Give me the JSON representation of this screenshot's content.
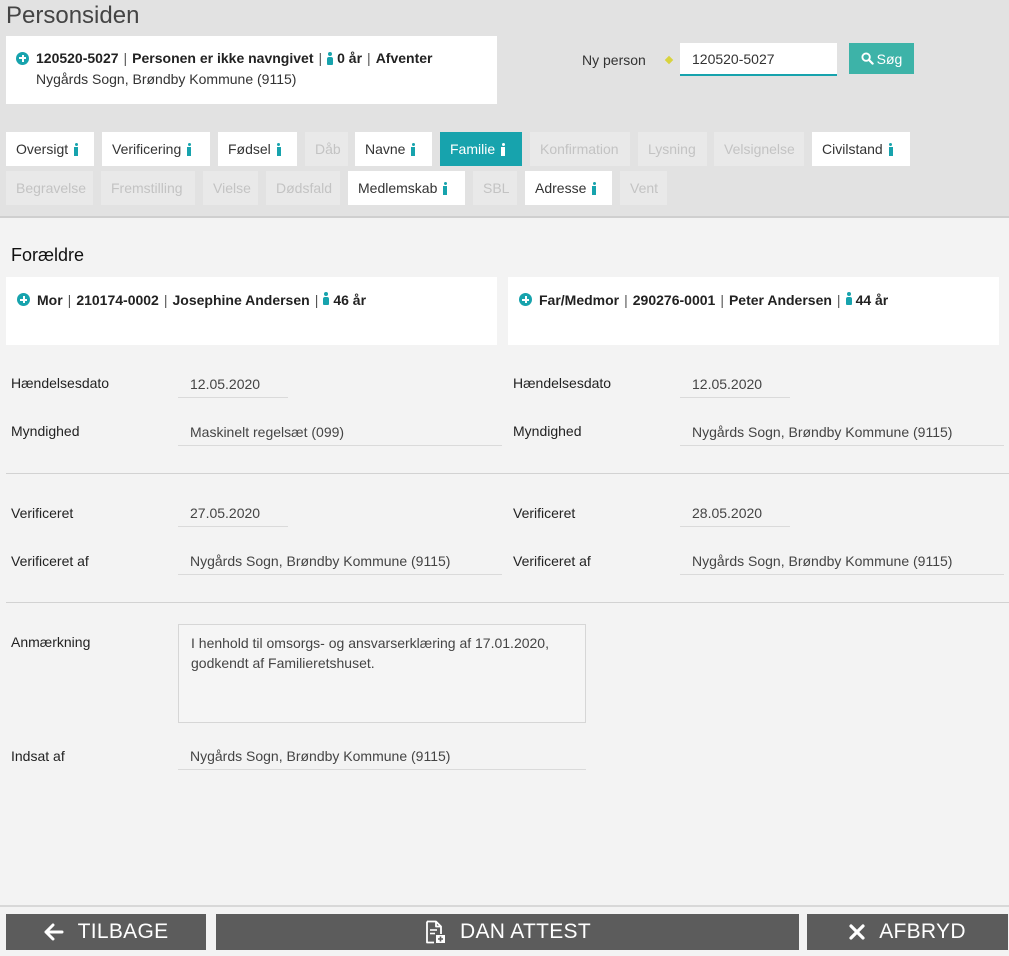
{
  "page_title": "Personsiden",
  "person": {
    "cpr": "120520-5027",
    "name": "Personen er ikke navngivet",
    "age": "0 år",
    "status": "Afventer",
    "authority": "Nygårds Sogn, Brøndby Kommune (9115)"
  },
  "search": {
    "label": "Ny person",
    "value": "120520-5027",
    "button_label": "Søg"
  },
  "tabs": [
    {
      "label": "Oversigt",
      "state": "enabled",
      "info": true
    },
    {
      "label": "Verificering",
      "state": "enabled",
      "info": true
    },
    {
      "label": "Fødsel",
      "state": "enabled",
      "info": true
    },
    {
      "label": "Dåb",
      "state": "disabled",
      "info": false
    },
    {
      "label": "Navne",
      "state": "enabled",
      "info": true
    },
    {
      "label": "Familie",
      "state": "active",
      "info": true
    },
    {
      "label": "Konfirmation",
      "state": "disabled",
      "info": false
    },
    {
      "label": "Lysning",
      "state": "disabled",
      "info": false
    },
    {
      "label": "Velsignelse",
      "state": "disabled",
      "info": false
    },
    {
      "label": "Civilstand",
      "state": "enabled",
      "info": true
    },
    {
      "label": "Begravelse",
      "state": "disabled",
      "info": false
    },
    {
      "label": "Fremstilling",
      "state": "disabled",
      "info": false
    },
    {
      "label": "Vielse",
      "state": "disabled",
      "info": false
    },
    {
      "label": "Dødsfald",
      "state": "disabled",
      "info": false
    },
    {
      "label": "Medlemskab",
      "state": "enabled",
      "info": true
    },
    {
      "label": "SBL",
      "state": "disabled",
      "info": false
    },
    {
      "label": "Adresse",
      "state": "enabled",
      "info": true
    },
    {
      "label": "Vent",
      "state": "disabled",
      "info": false
    }
  ],
  "section_title": "Forældre",
  "parents": [
    {
      "role": "Mor",
      "cpr_prefix": "210174-",
      "cpr_suffix": "0002",
      "name": "Josephine Andersen",
      "age": "46 år",
      "event_date": "12.05.2020",
      "authority": "Maskinelt regelsæt (099)",
      "verified": "27.05.2020",
      "verified_by": "Nygårds Sogn, Brøndby Kommune (9115)"
    },
    {
      "role": "Far/Medmor",
      "cpr_prefix": "290276-",
      "cpr_suffix": "0001",
      "name": "Peter Andersen",
      "age": "44 år",
      "event_date": "12.05.2020",
      "authority": "Nygårds Sogn, Brøndby Kommune (9115)",
      "verified": "28.05.2020",
      "verified_by": "Nygårds Sogn, Brøndby Kommune (9115)"
    }
  ],
  "labels": {
    "event_date": "Hændelsesdato",
    "authority": "Myndighed",
    "verified": "Verificeret",
    "verified_by": "Verificeret af",
    "remark": "Anmærkning",
    "submitted_by": "Indsat af"
  },
  "remark_line1": "I henhold til omsorgs- og ansvarserklæring af 17.01.2020,",
  "remark_line2": "godkendt af Familieretshuset.",
  "submitted_by": "Nygårds Sogn, Brøndby Kommune (9115)",
  "footer": {
    "back_label": "TILBAGE",
    "certificate_label": "DAN ATTEST",
    "cancel_label": "AFBRYD"
  },
  "colors": {
    "accent": "#17a3ad",
    "search_button": "#3db3a8",
    "footer_button": "#5c5c5c"
  }
}
